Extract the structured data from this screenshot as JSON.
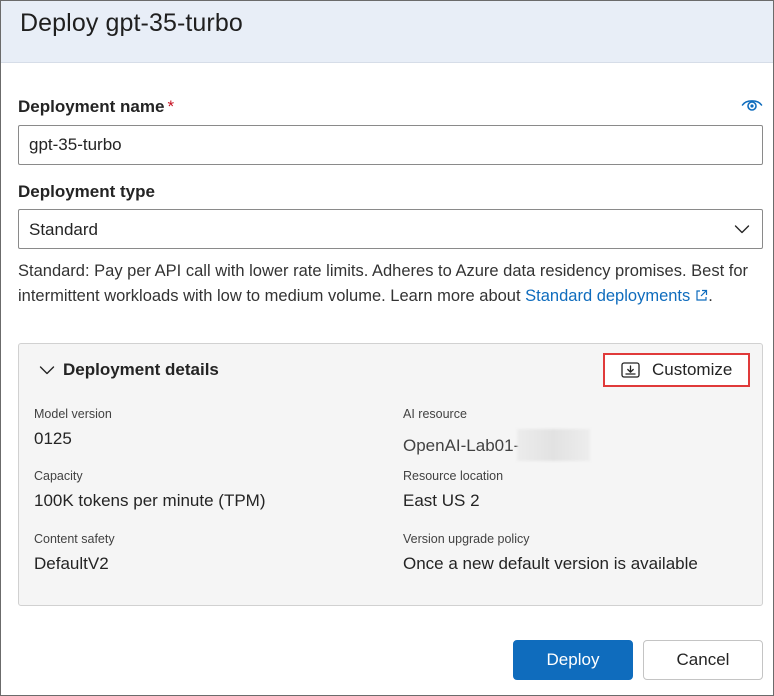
{
  "dialog": {
    "title": "Deploy gpt-35-turbo"
  },
  "deployment_name": {
    "label": "Deployment name",
    "required_marker": "*",
    "value": "gpt-35-turbo",
    "visibility_icon": "eye-icon"
  },
  "deployment_type": {
    "label": "Deployment type",
    "selected": "Standard",
    "description": "Standard: Pay per API call with lower rate limits. Adheres to Azure data residency promises. Best for intermittent workloads with low to medium volume. Learn more about ",
    "link_text": "Standard deployments",
    "link_suffix": "."
  },
  "details": {
    "title": "Deployment details",
    "customize_label": "Customize",
    "fields": {
      "model_version": {
        "label": "Model version",
        "value": "0125"
      },
      "ai_resource": {
        "label": "AI resource",
        "value": "OpenAI-Lab01-"
      },
      "capacity": {
        "label": "Capacity",
        "value": "100K tokens per minute (TPM)"
      },
      "resource_location": {
        "label": "Resource location",
        "value": "East US 2"
      },
      "content_safety": {
        "label": "Content safety",
        "value": "DefaultV2"
      },
      "version_upgrade_policy": {
        "label": "Version upgrade policy",
        "value": "Once a new default version is available"
      }
    }
  },
  "actions": {
    "deploy_label": "Deploy",
    "cancel_label": "Cancel"
  },
  "colors": {
    "accent": "#0f6cbd",
    "highlight_box": "#e03a3a",
    "header_bg": "#e8eef7",
    "panel_bg": "#f5f5f5"
  }
}
